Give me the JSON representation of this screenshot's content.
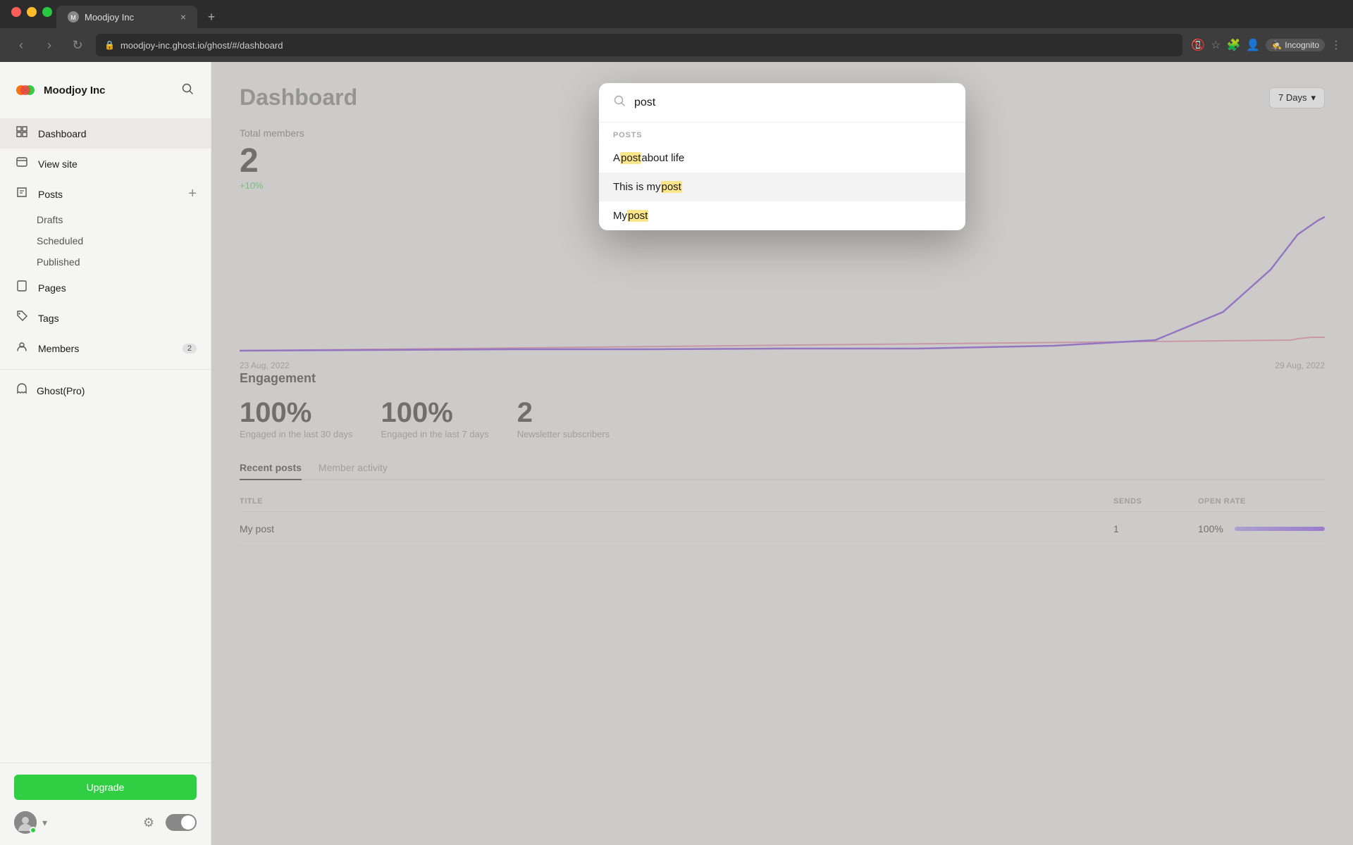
{
  "browser": {
    "tab_title": "Moodjoy Inc",
    "tab_close": "×",
    "tab_new": "+",
    "address": "moodjoy-inc.ghost.io/ghost/#/dashboard",
    "nav_back": "‹",
    "nav_forward": "›",
    "nav_refresh": "↻",
    "incognito_label": "Incognito",
    "chevron": "⌄"
  },
  "sidebar": {
    "brand_name": "Moodjoy Inc",
    "nav_items": [
      {
        "id": "dashboard",
        "label": "Dashboard",
        "icon": "⌂",
        "active": true
      },
      {
        "id": "view-site",
        "label": "View site",
        "icon": "⊞"
      },
      {
        "id": "posts",
        "label": "Posts",
        "icon": "✎",
        "has_add": true
      },
      {
        "id": "pages",
        "label": "Pages",
        "icon": "⬜"
      },
      {
        "id": "tags",
        "label": "Tags",
        "icon": "⧫"
      },
      {
        "id": "members",
        "label": "Members",
        "icon": "⊕",
        "count": "2"
      }
    ],
    "posts_sub": [
      "Drafts",
      "Scheduled",
      "Published"
    ],
    "ghost_pro_label": "Ghost(Pro)",
    "upgrade_label": "Upgrade",
    "toggle_icon": "☀"
  },
  "main": {
    "page_title": "Dashboard",
    "days_selector": "7 Days",
    "total_members_label": "Total members",
    "total_members_value": "2",
    "total_members_change": "+10%",
    "chart_start_label": "23 Aug, 2022",
    "chart_end_label": "29 Aug, 2022",
    "engagement_title": "Engagement",
    "engagement_stats": [
      {
        "value": "100%",
        "label": "Engaged in the last 30 days"
      },
      {
        "value": "100%",
        "label": "Engaged in the last 7 days"
      },
      {
        "value": "2",
        "label": "Newsletter subscribers"
      }
    ],
    "recent_posts_tab": "Recent posts",
    "member_activity_tab": "Member activity",
    "table_headers": [
      "TITLE",
      "SENDS",
      "OPEN RATE"
    ],
    "table_rows": [
      {
        "title": "My post",
        "sends": "1",
        "rate": "100%",
        "rate_pct": 100
      }
    ]
  },
  "search": {
    "placeholder": "post",
    "value": "post",
    "section_label": "POSTS",
    "results": [
      {
        "id": "result-1",
        "before": "A ",
        "highlight": "post",
        "after": " about life"
      },
      {
        "id": "result-2",
        "before": "This is my ",
        "highlight": "post",
        "after": ""
      },
      {
        "id": "result-3",
        "before": "My ",
        "highlight": "post",
        "after": ""
      }
    ]
  }
}
